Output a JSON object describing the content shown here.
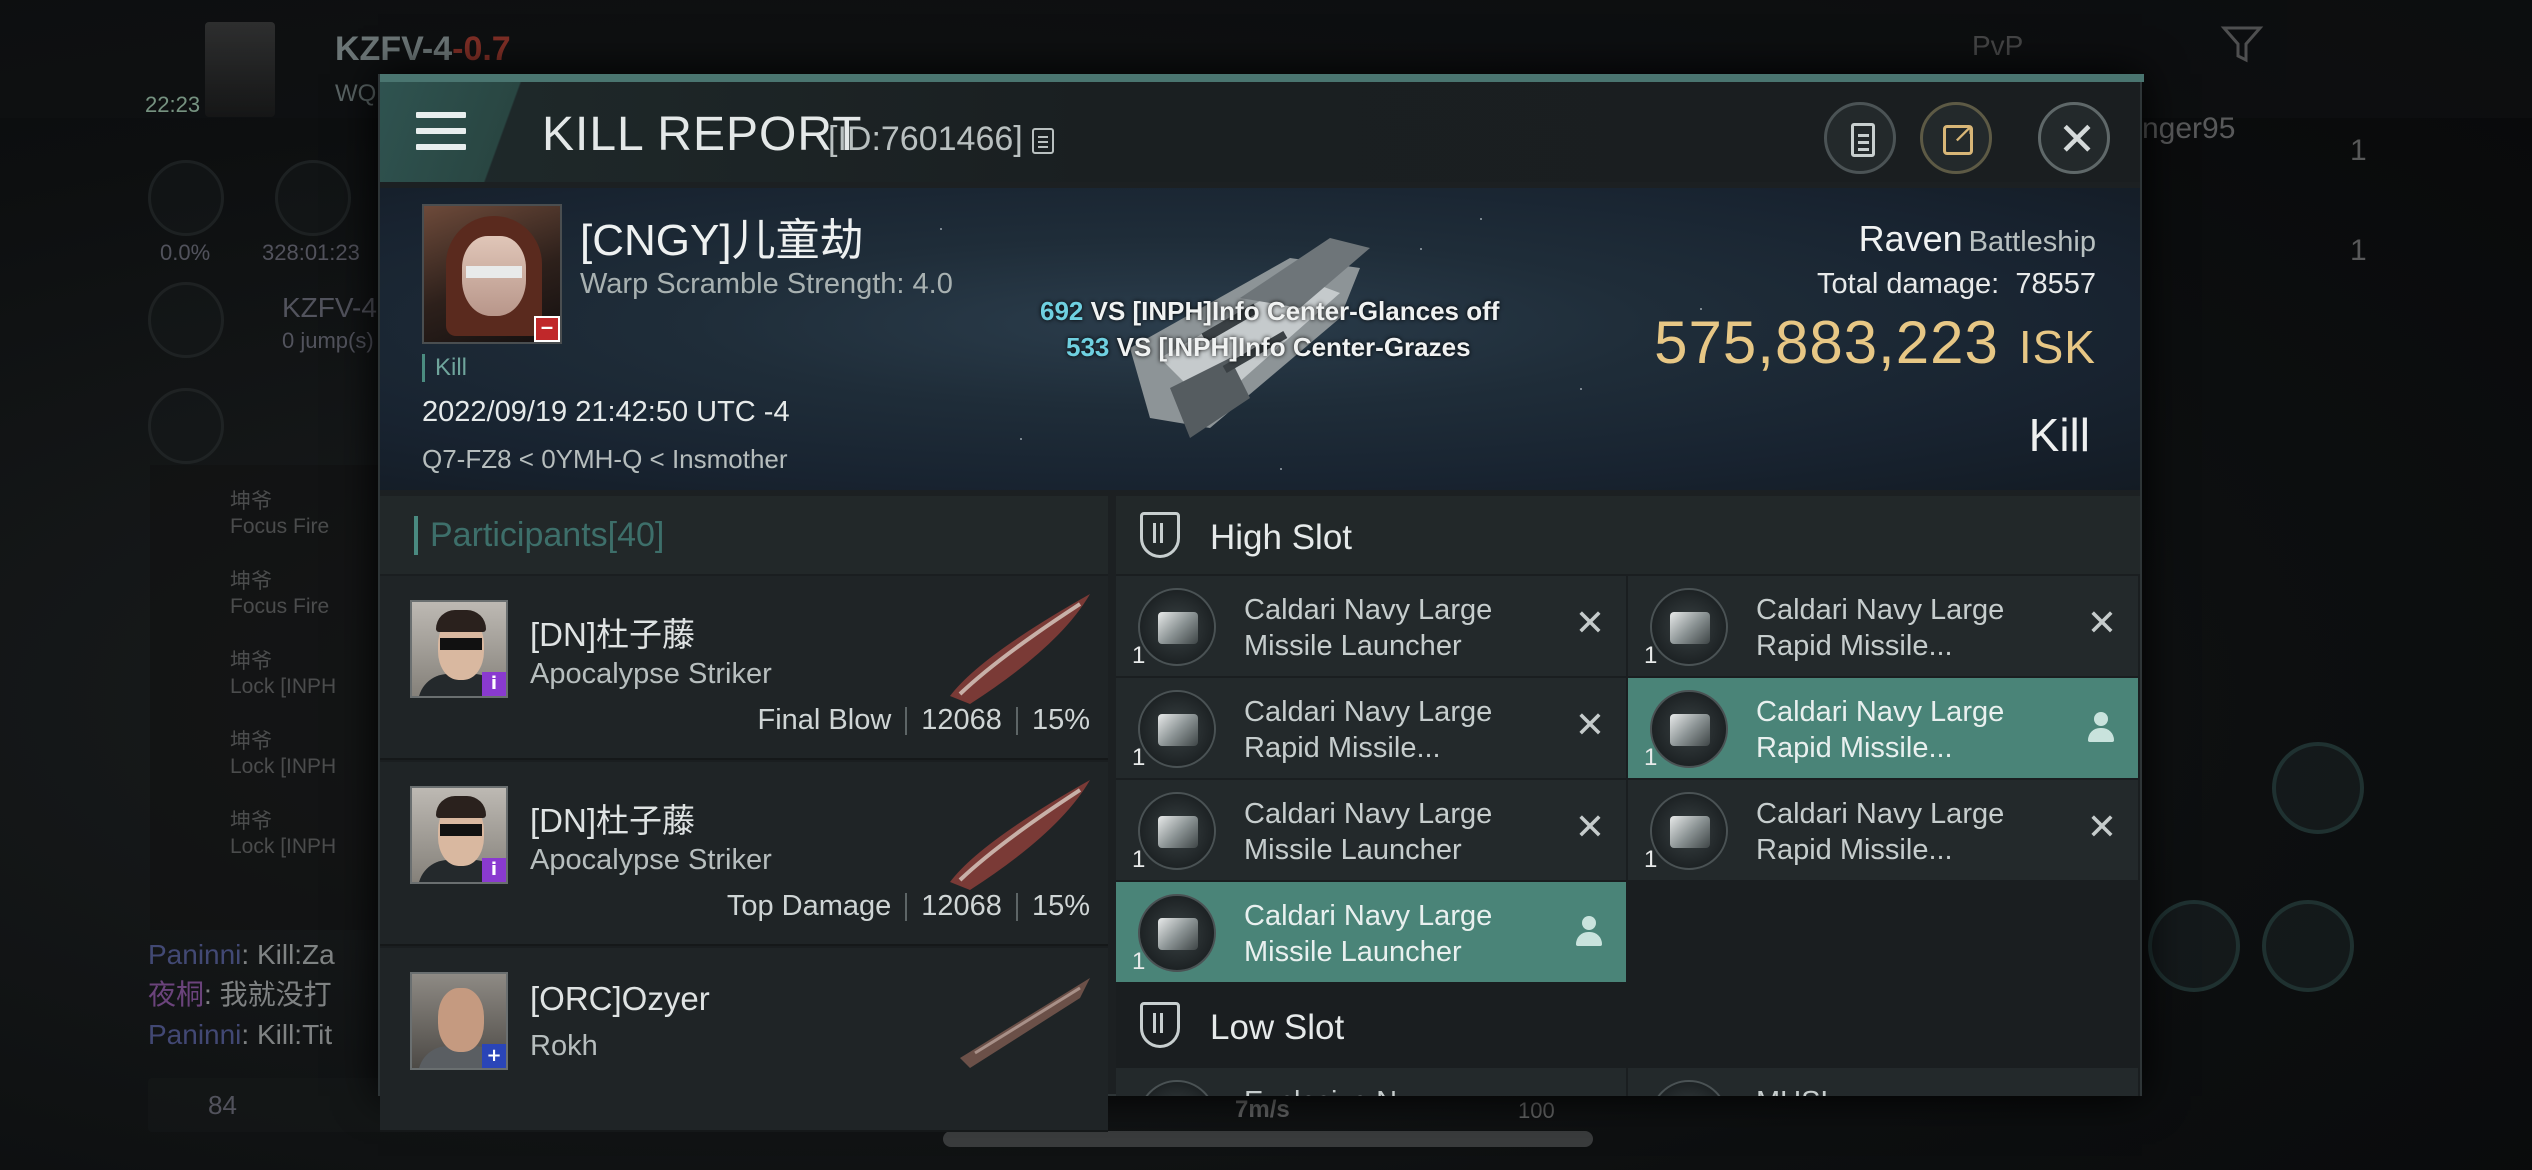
{
  "background": {
    "system_name": "KZFV-4",
    "security": "-0.7",
    "sub": "WQ",
    "clock": "22:23",
    "pvp_label": "PvP",
    "stat_a": "0.0%",
    "stat_b": "328:01:23",
    "route_name": "KZFV-4",
    "route_jumps": "0 jump(s)",
    "feed": [
      {
        "name": "坤爷",
        "action": "Focus Fire"
      },
      {
        "name": "坤爷",
        "action": "Focus Fire"
      },
      {
        "name": "坤爷",
        "action": "Lock [INPH"
      },
      {
        "name": "坤爷",
        "action": "Lock [INPH"
      },
      {
        "name": "坤爷",
        "action": "Lock [INPH"
      }
    ],
    "chat": [
      {
        "name": "Paninni",
        "text": ": Kill:Za"
      },
      {
        "name": "夜桐",
        "text": ": 我就没打"
      },
      {
        "name": "Paninni",
        "text": ": Kill:Tit"
      }
    ],
    "bottom_count": "84",
    "speed": "7m/s",
    "throttle": "100",
    "right_name": "nger95",
    "right_count_a": "1",
    "right_count_b": "1"
  },
  "header": {
    "title": "KILL REPORT",
    "id_text": "[ID:7601466]"
  },
  "victim": {
    "name": "[CNGY]儿童劫",
    "warp_scramble": "Warp Scramble Strength: 4.0",
    "kill_tag": "Kill",
    "datetime": "2022/09/19 21:42:50 UTC -4",
    "location": "Q7-FZ8 < 0YMH-Q < Insmother",
    "ship": "Raven",
    "ship_class": "Battleship",
    "total_damage_label": "Total damage:",
    "total_damage": "78557",
    "isk_value": "575,883,223",
    "isk_unit": "ISK",
    "result": "Kill"
  },
  "damage_lines": [
    {
      "value": "692",
      "text": " VS [INPH]Info Center-Glances off"
    },
    {
      "value": "533",
      "text": " VS [INPH]Info Center-Grazes"
    }
  ],
  "participants": {
    "label": "Participants",
    "count": "[40]",
    "rows": [
      {
        "name": "[DN]杜子藤",
        "ship": "Apocalypse Striker",
        "tag": "Final Blow",
        "damage": "12068",
        "percent": "15%",
        "badge": "i"
      },
      {
        "name": "[DN]杜子藤",
        "ship": "Apocalypse Striker",
        "tag": "Top Damage",
        "damage": "12068",
        "percent": "15%",
        "badge": "i"
      },
      {
        "name": "[ORC]Ozyer",
        "ship": "Rokh",
        "tag": "",
        "damage": "",
        "percent": "",
        "badge": "+"
      }
    ]
  },
  "fitting": {
    "high_slot_label": "High Slot",
    "low_slot_label": "Low Slot",
    "high_slots": [
      {
        "name": "Caldari Navy Large Missile Launcher",
        "qty": "1",
        "state": "destroyed"
      },
      {
        "name": "Caldari Navy Large Rapid Missile...",
        "qty": "1",
        "state": "destroyed"
      },
      {
        "name": "Caldari Navy Large Rapid Missile...",
        "qty": "1",
        "state": "destroyed"
      },
      {
        "name": "Caldari Navy Large Rapid Missile...",
        "qty": "1",
        "state": "dropped"
      },
      {
        "name": "Caldari Navy Large Missile Launcher",
        "qty": "1",
        "state": "destroyed"
      },
      {
        "name": "Caldari Navy Large Rapid Missile...",
        "qty": "1",
        "state": "destroyed"
      },
      {
        "name": "Caldari Navy Large Missile Launcher",
        "qty": "1",
        "state": "dropped"
      }
    ],
    "low_slots_partial": [
      {
        "name": "Explosive N..."
      },
      {
        "name": "MUSL..."
      }
    ]
  },
  "icons": {
    "menu": "hamburger-icon",
    "copy": "copy-icon",
    "report": "clipboard-icon",
    "share": "share-icon",
    "close": "close-icon",
    "destroyed": "x-icon",
    "dropped": "person-icon",
    "slot": "shield-icon"
  },
  "colors": {
    "accent": "#4a8478",
    "isk": "#e7c785",
    "damage_number": "#6fd0e0",
    "negative_badge": "#c0282a"
  }
}
